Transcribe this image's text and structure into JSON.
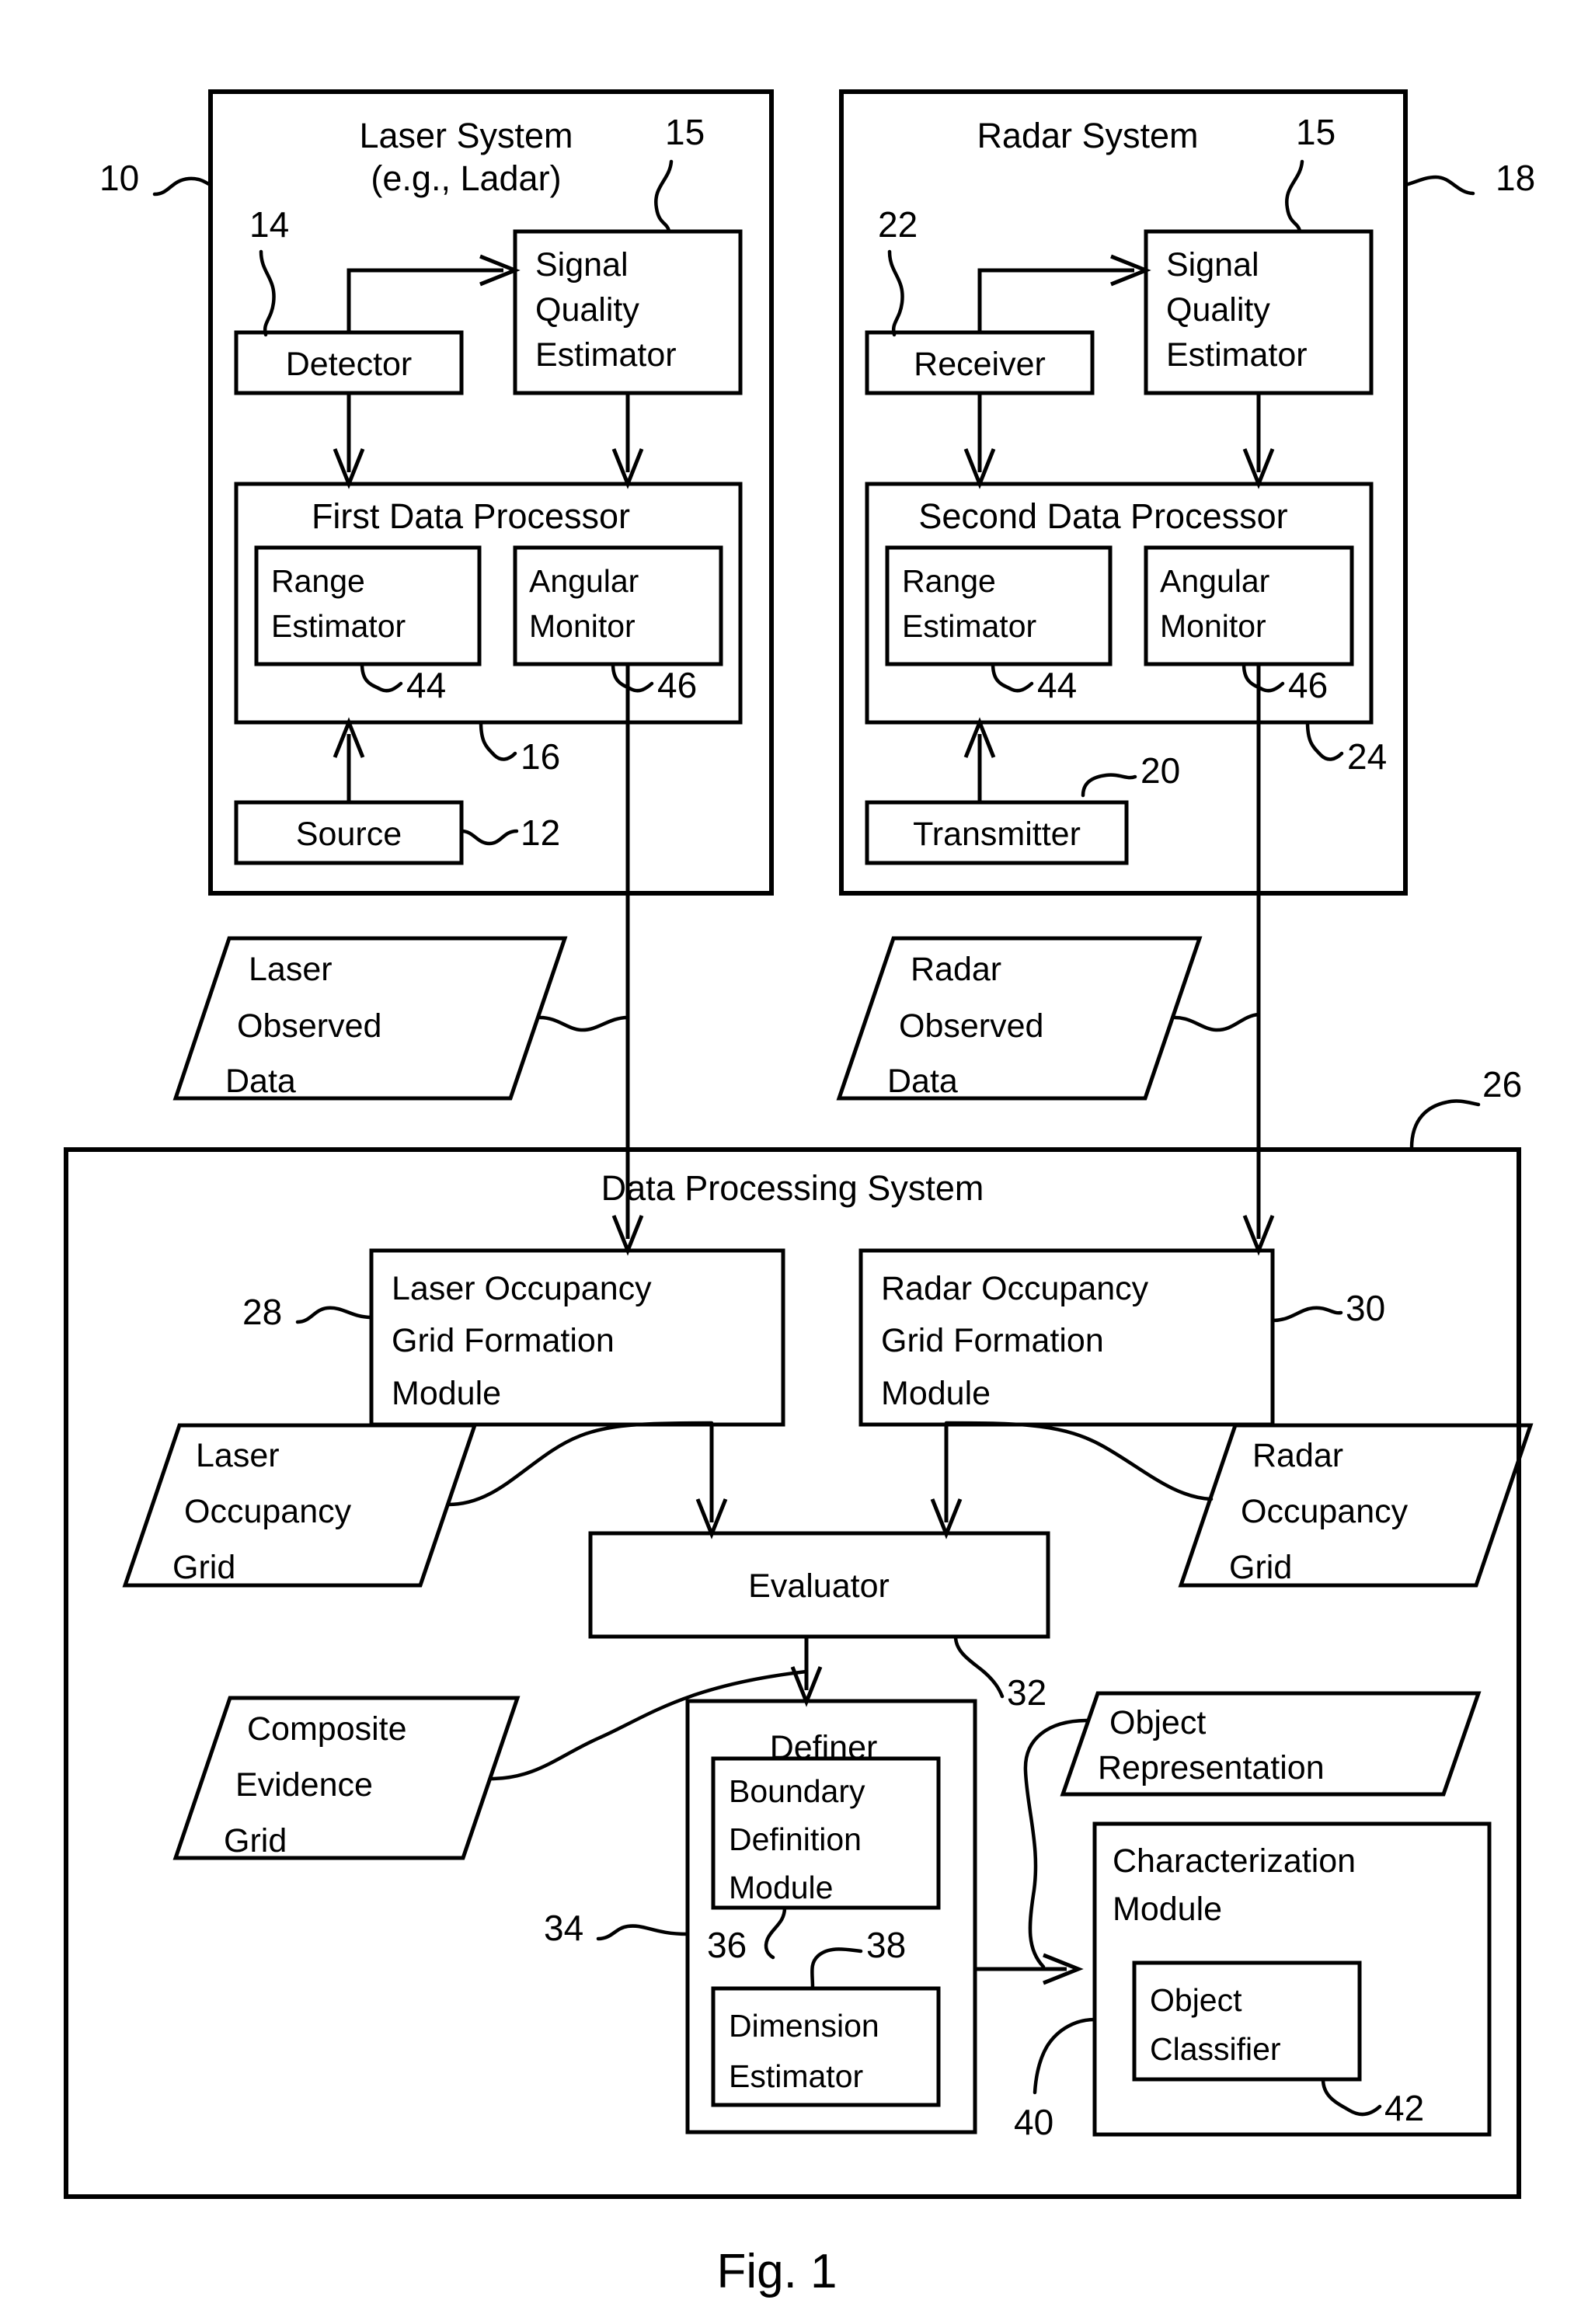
{
  "figure": {
    "caption": "Fig. 1",
    "laser_system": {
      "title_line1": "Laser System",
      "title_line2": "(e.g., Ladar)",
      "ref": "10",
      "detector": {
        "label": "Detector",
        "ref": "14"
      },
      "signal_quality_estimator": {
        "line1": "Signal",
        "line2": "Quality",
        "line3": "Estimator",
        "ref": "15"
      },
      "first_data_processor": {
        "title": "First Data Processor",
        "ref": "16"
      },
      "range_estimator": {
        "line1": "Range",
        "line2": "Estimator",
        "ref": "44"
      },
      "angular_monitor": {
        "line1": "Angular",
        "line2": "Monitor",
        "ref": "46"
      },
      "source": {
        "label": "Source",
        "ref": "12"
      }
    },
    "radar_system": {
      "title_line1": "Radar System",
      "ref": "18",
      "receiver": {
        "label": "Receiver",
        "ref": "22"
      },
      "signal_quality_estimator": {
        "line1": "Signal",
        "line2": "Quality",
        "line3": "Estimator",
        "ref": "15"
      },
      "second_data_processor": {
        "title": "Second Data Processor",
        "ref": "24"
      },
      "range_estimator": {
        "line1": "Range",
        "line2": "Estimator",
        "ref": "44"
      },
      "angular_monitor": {
        "line1": "Angular",
        "line2": "Monitor",
        "ref": "46"
      },
      "transmitter": {
        "label": "Transmitter",
        "ref": "20"
      }
    },
    "laser_observed_data": {
      "line1": "Laser",
      "line2": "Observed",
      "line3": "Data"
    },
    "radar_observed_data": {
      "line1": "Radar",
      "line2": "Observed",
      "line3": "Data"
    },
    "data_processing_system": {
      "title": "Data Processing System",
      "ref": "26",
      "laser_occupancy_grid_formation_module": {
        "line1": "Laser Occupancy",
        "line2": "Grid Formation",
        "line3": "Module",
        "ref": "28"
      },
      "radar_occupancy_grid_formation_module": {
        "line1": "Radar Occupancy",
        "line2": "Grid Formation",
        "line3": "Module",
        "ref": "30"
      },
      "laser_occupancy_grid": {
        "line1": "Laser",
        "line2": "Occupancy",
        "line3": "Grid"
      },
      "radar_occupancy_grid": {
        "line1": "Radar",
        "line2": "Occupancy",
        "line3": "Grid"
      },
      "evaluator": {
        "label": "Evaluator",
        "ref": "32"
      },
      "composite_evidence_grid": {
        "line1": "Composite",
        "line2": "Evidence",
        "line3": "Grid"
      },
      "definer": {
        "title": "Definer",
        "ref": "34"
      },
      "boundary_definition_module": {
        "line1": "Boundary",
        "line2": "Definition",
        "line3": "Module",
        "ref": "36"
      },
      "dimension_estimator": {
        "line1": "Dimension",
        "line2": "Estimator",
        "ref": "38"
      },
      "object_representation": {
        "line1": "Object",
        "line2": "Representation",
        "ref": "40"
      },
      "characterization_module": {
        "line1": "Characterization",
        "line2": "Module"
      },
      "object_classifier": {
        "line1": "Object",
        "line2": "Classifier",
        "ref": "42"
      }
    }
  }
}
